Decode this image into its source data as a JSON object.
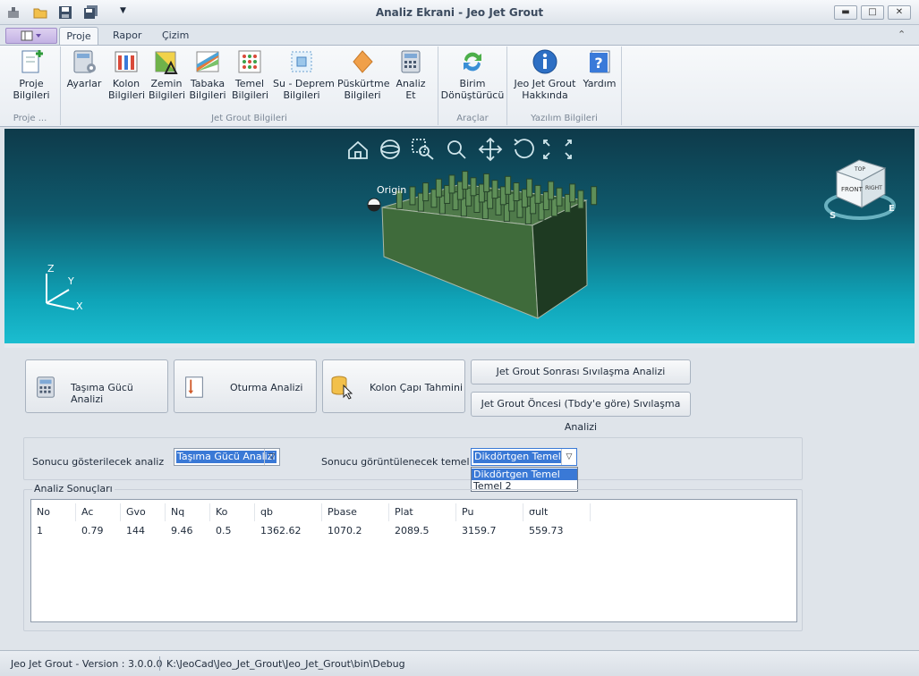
{
  "window": {
    "title": "Analiz Ekrani - Jeo Jet Grout",
    "min": "▬",
    "max": "□",
    "close": "✕"
  },
  "tabs": {
    "proje": "Proje",
    "rapor": "Rapor",
    "cizim": "Çizim"
  },
  "ribbon": {
    "proje_bilgileri": "Proje\nBilgileri",
    "group_proje": "Proje ...",
    "ayarlar": "Ayarlar",
    "kolon": "Kolon\nBilgileri",
    "zemin": "Zemin\nBilgileri",
    "tabaka": "Tabaka\nBilgileri",
    "temel": "Temel\nBilgileri",
    "su_deprem": "Su - Deprem\nBilgileri",
    "puskurtme": "Püskürtme\nBilgileri",
    "analiz": "Analiz\nEt",
    "group_jet": "Jet Grout Bilgileri",
    "birim": "Birim\nDönüştürücü",
    "group_araclar": "Araçlar",
    "hakkinda": "Jeo Jet Grout\nHakkında",
    "yardim": "Yardım",
    "group_yazilim": "Yazılım Bilgileri"
  },
  "viewport": {
    "origin_label": "Origin",
    "axis_x": "X",
    "axis_y": "Y",
    "axis_z": "Z",
    "cube_front": "FRONT",
    "cube_right": "RIGHT",
    "cube_top": "TOP",
    "compass_s": "S",
    "compass_e": "E"
  },
  "buttons": {
    "tasima": "Taşıma Gücü Analizi",
    "oturma": "Oturma Analizi",
    "kolon_capi": "Kolon Çapı Tahmini",
    "sonrasi": "Jet Grout Sonrası Sıvılaşma Analizi",
    "oncesi": "Jet Grout Öncesi (Tbdy'e göre) Sıvılaşma Analizi"
  },
  "selection": {
    "analiz_label": "Sonucu gösterilecek analiz",
    "analiz_value": "Taşıma Gücü Analizi",
    "temel_label": "Sonucu görüntülenecek temel",
    "temel_value": "Dikdörtgen Temel",
    "temel_options": [
      "Dikdörtgen Temel",
      "Temel 2"
    ]
  },
  "results": {
    "title": "Analiz Sonuçları",
    "columns": [
      "No",
      "Ac",
      "Gvo",
      "Nq",
      "Ko",
      "qb",
      "Pbase",
      "Plat",
      "Pu",
      "σult"
    ],
    "rows": [
      [
        "1",
        "0.79",
        "144",
        "9.46",
        "0.5",
        "1362.62",
        "1070.2",
        "2089.5",
        "3159.7",
        "559.73"
      ]
    ]
  },
  "status": {
    "version": "Jeo Jet Grout - Version : 3.0.0.0",
    "path": "K:\\JeoCad\\Jeo_Jet_Grout\\Jeo_Jet_Grout\\bin\\Debug"
  }
}
